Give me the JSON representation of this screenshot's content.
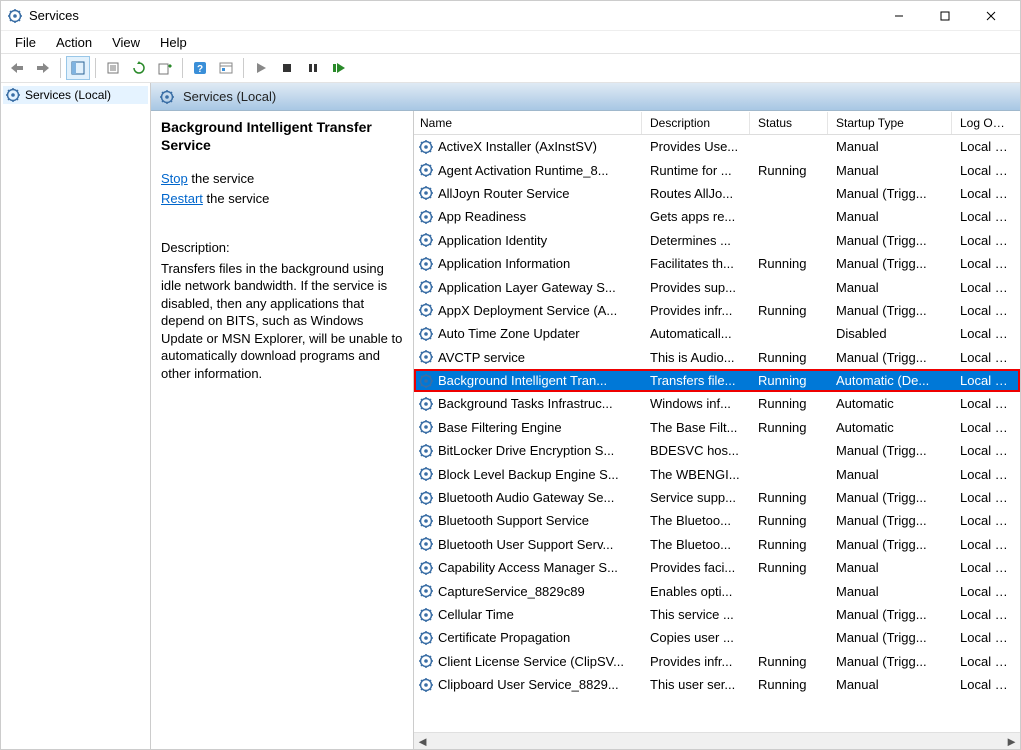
{
  "window": {
    "title": "Services"
  },
  "menu": {
    "items": [
      "File",
      "Action",
      "View",
      "Help"
    ]
  },
  "nav": {
    "tree_label": "Services (Local)"
  },
  "content": {
    "heading": "Services (Local)"
  },
  "details": {
    "service_name_l1": "Background Intelligent Transfer",
    "service_name_l2": "Service",
    "stop_link": "Stop",
    "stop_rest": " the service",
    "restart_link": "Restart",
    "restart_rest": " the service",
    "desc_label": "Description:",
    "desc_text": "Transfers files in the background using idle network bandwidth. If the service is disabled, then any applications that depend on BITS, such as Windows Update or MSN Explorer, will be unable to automatically download programs and other information."
  },
  "columns": {
    "name": "Name",
    "description": "Description",
    "status": "Status",
    "startup": "Startup Type",
    "logon": "Log On A"
  },
  "services": [
    {
      "name": "ActiveX Installer (AxInstSV)",
      "desc": "Provides Use...",
      "status": "",
      "startup": "Manual",
      "logon": "Local Sys"
    },
    {
      "name": "Agent Activation Runtime_8...",
      "desc": "Runtime for ...",
      "status": "Running",
      "startup": "Manual",
      "logon": "Local Sys"
    },
    {
      "name": "AllJoyn Router Service",
      "desc": "Routes AllJo...",
      "status": "",
      "startup": "Manual (Trigg...",
      "logon": "Local Ser"
    },
    {
      "name": "App Readiness",
      "desc": "Gets apps re...",
      "status": "",
      "startup": "Manual",
      "logon": "Local Sys"
    },
    {
      "name": "Application Identity",
      "desc": "Determines ...",
      "status": "",
      "startup": "Manual (Trigg...",
      "logon": "Local Ser"
    },
    {
      "name": "Application Information",
      "desc": "Facilitates th...",
      "status": "Running",
      "startup": "Manual (Trigg...",
      "logon": "Local Sys"
    },
    {
      "name": "Application Layer Gateway S...",
      "desc": "Provides sup...",
      "status": "",
      "startup": "Manual",
      "logon": "Local Ser"
    },
    {
      "name": "AppX Deployment Service (A...",
      "desc": "Provides infr...",
      "status": "Running",
      "startup": "Manual (Trigg...",
      "logon": "Local Sys"
    },
    {
      "name": "Auto Time Zone Updater",
      "desc": "Automaticall...",
      "status": "",
      "startup": "Disabled",
      "logon": "Local Ser"
    },
    {
      "name": "AVCTP service",
      "desc": "This is Audio...",
      "status": "Running",
      "startup": "Manual (Trigg...",
      "logon": "Local Ser"
    },
    {
      "name": "Background Intelligent Tran...",
      "desc": "Transfers file...",
      "status": "Running",
      "startup": "Automatic (De...",
      "logon": "Local Sys",
      "selected": true,
      "highlighted": true
    },
    {
      "name": "Background Tasks Infrastruc...",
      "desc": "Windows inf...",
      "status": "Running",
      "startup": "Automatic",
      "logon": "Local Sys"
    },
    {
      "name": "Base Filtering Engine",
      "desc": "The Base Filt...",
      "status": "Running",
      "startup": "Automatic",
      "logon": "Local Ser"
    },
    {
      "name": "BitLocker Drive Encryption S...",
      "desc": "BDESVC hos...",
      "status": "",
      "startup": "Manual (Trigg...",
      "logon": "Local Sys"
    },
    {
      "name": "Block Level Backup Engine S...",
      "desc": "The WBENGI...",
      "status": "",
      "startup": "Manual",
      "logon": "Local Sys"
    },
    {
      "name": "Bluetooth Audio Gateway Se...",
      "desc": "Service supp...",
      "status": "Running",
      "startup": "Manual (Trigg...",
      "logon": "Local Ser"
    },
    {
      "name": "Bluetooth Support Service",
      "desc": "The Bluetoo...",
      "status": "Running",
      "startup": "Manual (Trigg...",
      "logon": "Local Ser"
    },
    {
      "name": "Bluetooth User Support Serv...",
      "desc": "The Bluetoo...",
      "status": "Running",
      "startup": "Manual (Trigg...",
      "logon": "Local Sys"
    },
    {
      "name": "Capability Access Manager S...",
      "desc": "Provides faci...",
      "status": "Running",
      "startup": "Manual",
      "logon": "Local Sys"
    },
    {
      "name": "CaptureService_8829c89",
      "desc": "Enables opti...",
      "status": "",
      "startup": "Manual",
      "logon": "Local Sys"
    },
    {
      "name": "Cellular Time",
      "desc": "This service ...",
      "status": "",
      "startup": "Manual (Trigg...",
      "logon": "Local Ser"
    },
    {
      "name": "Certificate Propagation",
      "desc": "Copies user ...",
      "status": "",
      "startup": "Manual (Trigg...",
      "logon": "Local Sys"
    },
    {
      "name": "Client License Service (ClipSV...",
      "desc": "Provides infr...",
      "status": "Running",
      "startup": "Manual (Trigg...",
      "logon": "Local Sys"
    },
    {
      "name": "Clipboard User Service_8829...",
      "desc": "This user ser...",
      "status": "Running",
      "startup": "Manual",
      "logon": "Local Sys"
    }
  ]
}
